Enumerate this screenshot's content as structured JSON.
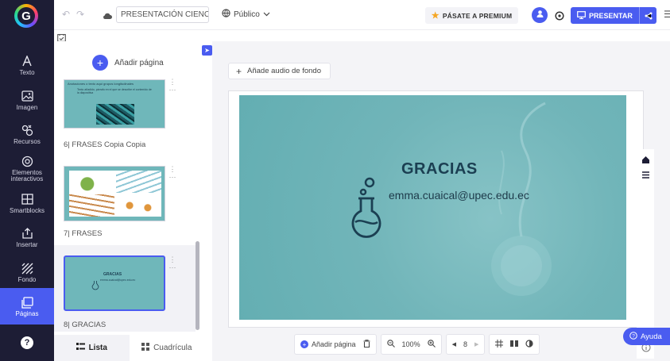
{
  "rail": {
    "items": [
      {
        "label": "Texto",
        "icon": "text-icon"
      },
      {
        "label": "Imagen",
        "icon": "image-icon"
      },
      {
        "label": "Recursos",
        "icon": "resources-icon"
      },
      {
        "label": "Elementos interactivos",
        "icon": "interactive-icon"
      },
      {
        "label": "Smartblocks",
        "icon": "smartblocks-icon"
      },
      {
        "label": "Insertar",
        "icon": "insert-icon"
      },
      {
        "label": "Fondo",
        "icon": "background-icon"
      },
      {
        "label": "Páginas",
        "icon": "pages-icon"
      }
    ],
    "help_glyph": "?"
  },
  "topbar": {
    "title": "PRESENTACIÓN CIENCIA...",
    "visibility": "Público",
    "premium": "PÁSATE A PREMIUM",
    "present": "PRESENTAR"
  },
  "pages": {
    "add_page": "Añadir página",
    "items": [
      {
        "label": "6| FRASES Copia Copia"
      },
      {
        "label": "7| FRASES"
      },
      {
        "label": "8| GRACIAS"
      }
    ],
    "thumb_6_lines": [
      "Anotaciones o texto aquí grupos longitudinales",
      "Texto añadido, párrafo en el que se describe el contenido de la diapositiva"
    ],
    "thumb_8_title": "GRACIAS",
    "thumb_8_email": "emma.cuaical@upec.edu.ec",
    "view_list": "Lista",
    "view_grid": "Cuadrícula"
  },
  "canvas": {
    "audio": "Añade audio de fondo",
    "slide_title": "GRACIAS",
    "slide_email": "emma.cuaical@upec.edu.ec",
    "bottom": {
      "add_page": "Añadir página",
      "zoom": "100%",
      "page_number": "8"
    },
    "help": "Ayuda"
  },
  "colors": {
    "rail_bg": "#1d1d35",
    "accent": "#4a5cf0",
    "slide_bg": "#6fb4b8",
    "slide_text": "#1b3f52"
  }
}
